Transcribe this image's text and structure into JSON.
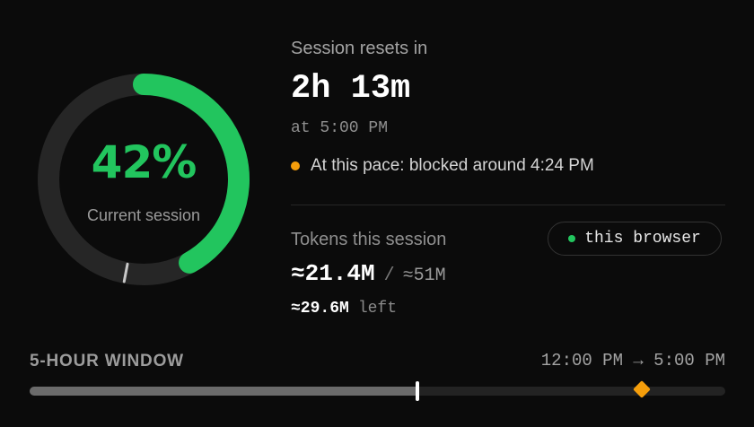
{
  "usage": {
    "percent_label": "42%",
    "percent_value": 0.42,
    "label": "Current session",
    "pace_marker_fraction": 0.53,
    "accent_color": "#22c55e",
    "track_color": "#262626",
    "pace_marker_color": "#c8c8c8"
  },
  "session": {
    "resets_label": "Session resets in",
    "resets_time": "2h 13m",
    "resets_at": "at 5:00 PM",
    "pace_icon": "warning-dot-icon",
    "pace_color": "#f59e0b",
    "pace_text": "At this pace: blocked around 4:24 PM"
  },
  "tokens": {
    "label": "Tokens this session",
    "badge_icon": "status-dot-icon",
    "badge_text": "this browser",
    "used": "≈21.4M",
    "separator": "/",
    "total": "≈51M",
    "left_value": "≈29.6M",
    "left_suffix": "left"
  },
  "window": {
    "label": "5-HOUR WINDOW",
    "range": "12:00 PM → 5:00 PM",
    "elapsed_fraction": 0.557,
    "blocked_fraction": 0.88
  }
}
